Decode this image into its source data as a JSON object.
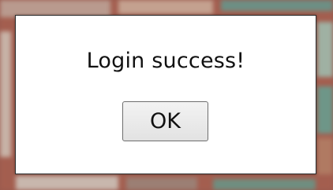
{
  "dialog": {
    "message": "Login success!",
    "ok_label": "OK"
  }
}
